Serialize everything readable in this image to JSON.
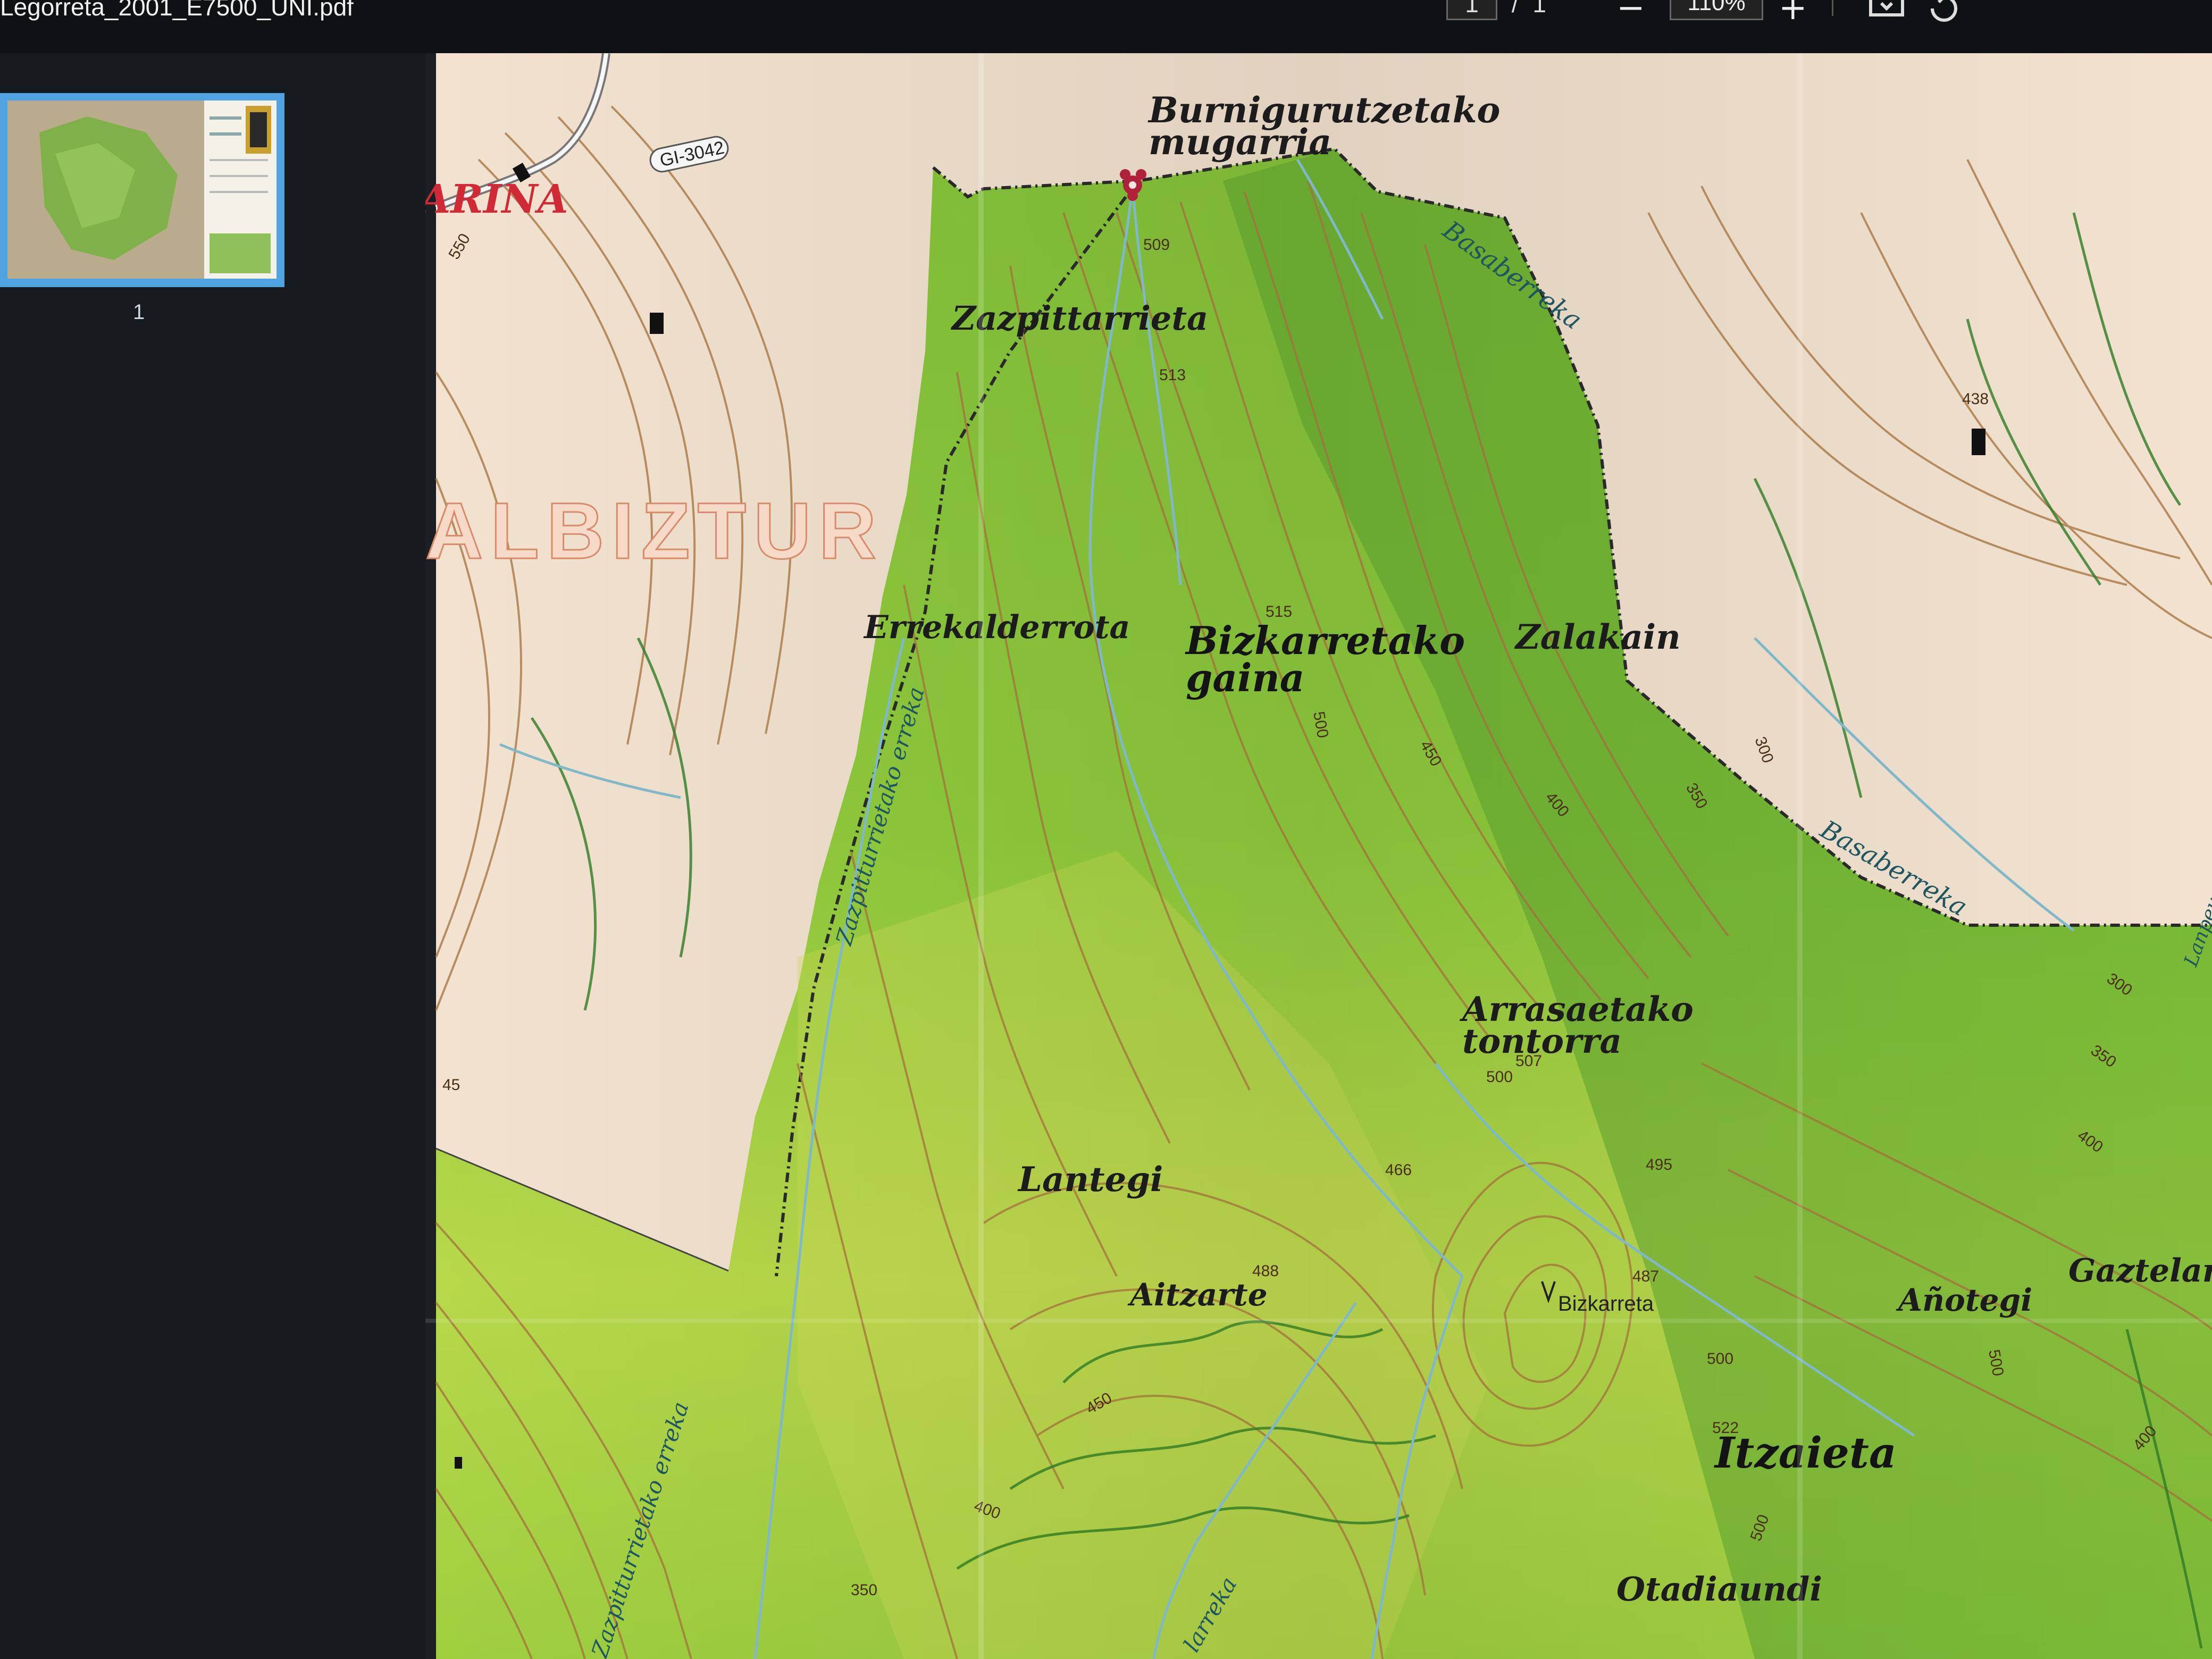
{
  "window": {
    "file_title": "Legorreta_2001_E7500_UNI.pdf",
    "page_current": "1",
    "page_separator": "/",
    "page_total": "1",
    "zoom_out": "−",
    "zoom_level": "110%",
    "zoom_in": "+"
  },
  "sidebar": {
    "thumbnail_page_number": "1"
  },
  "map": {
    "road_label": "GI-3042",
    "municipality_label": "ALBIZTUR",
    "partial_label": "ARINA",
    "place_names": {
      "burnigurutzetako_line1": "Burnigurutzetako",
      "burnigurutzetako_line2": "mugarria",
      "zazpittarrieta": "Zazpittarrieta",
      "errekalderrota": "Errekalderrota",
      "bizkarretako_line1": "Bizkarretako",
      "bizkarretako_line2": "gaina",
      "zalakain": "Zalakain",
      "arrasaetako_line1": "Arrasaetako",
      "arrasaetako_line2": "tontorra",
      "lantegi": "Lantegi",
      "aitzarte": "Aitzarte",
      "bizkarreta": "Bizkarreta",
      "anotegi": "Añotegi",
      "gaztelara": "Gaztelara",
      "itzaieta": "Itzaieta",
      "otadiaundi": "Otadiaundi"
    },
    "streams": {
      "basaberreka_1": "Basaberreka",
      "basaberreka_2": "Basaberreka",
      "zazpitturrietako_erreka": "Zazpitturrietako erreka",
      "zazpitturrietako_erreka_lower": "Zazpitturrietako erreka",
      "larreka": "larreka",
      "lanpeu_partial": "Lanpeu"
    },
    "spot_heights": {
      "e509": "509",
      "e513": "513",
      "e515": "515",
      "e500a": "500",
      "e450a": "450",
      "e400a": "400",
      "e350a": "350",
      "e300a": "300",
      "e438": "438",
      "e550": "550",
      "e507": "507",
      "e500b": "500",
      "e466": "466",
      "e495": "495",
      "e488": "488",
      "e487": "487",
      "e500c": "500",
      "e522": "522",
      "e450b": "450",
      "e400b": "400",
      "e350b": "350",
      "e500d": "500",
      "e300b": "300",
      "e350c": "350",
      "e400c": "400",
      "e400d": "400",
      "e45": "45",
      "e500e": "500"
    },
    "colors": {
      "forest_green": "#8fc93a",
      "open_land": "#f3e3d0",
      "contour_brown": "#a4703c",
      "boundary": "#2a2a2a",
      "stream_blue": "#7fb8c8",
      "landmark_red": "#b0223a"
    }
  }
}
